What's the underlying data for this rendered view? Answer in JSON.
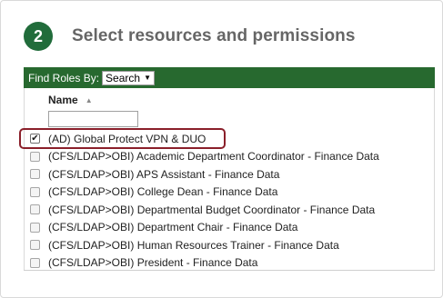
{
  "step": {
    "number": "2",
    "title": "Select resources and permissions"
  },
  "find_bar": {
    "label": "Find Roles By:",
    "select_value": "Search"
  },
  "table": {
    "column_header": "Name",
    "filter_value": "",
    "rows": [
      {
        "label": "(AD) Global Protect VPN & DUO",
        "checked": true
      },
      {
        "label": "(CFS/LDAP>OBI) Academic Department Coordinator - Finance Data",
        "checked": false
      },
      {
        "label": "(CFS/LDAP>OBI) APS Assistant - Finance Data",
        "checked": false
      },
      {
        "label": "(CFS/LDAP>OBI) College Dean - Finance Data",
        "checked": false
      },
      {
        "label": "(CFS/LDAP>OBI) Departmental Budget Coordinator - Finance Data",
        "checked": false
      },
      {
        "label": "(CFS/LDAP>OBI) Department Chair - Finance Data",
        "checked": false
      },
      {
        "label": "(CFS/LDAP>OBI) Human Resources Trainer - Finance Data",
        "checked": false
      },
      {
        "label": "(CFS/LDAP>OBI) President - Finance Data",
        "checked": false
      }
    ]
  },
  "colors": {
    "step_circle": "#216c3b",
    "find_bar": "#27692f",
    "highlight_border": "#8a1f2a"
  }
}
